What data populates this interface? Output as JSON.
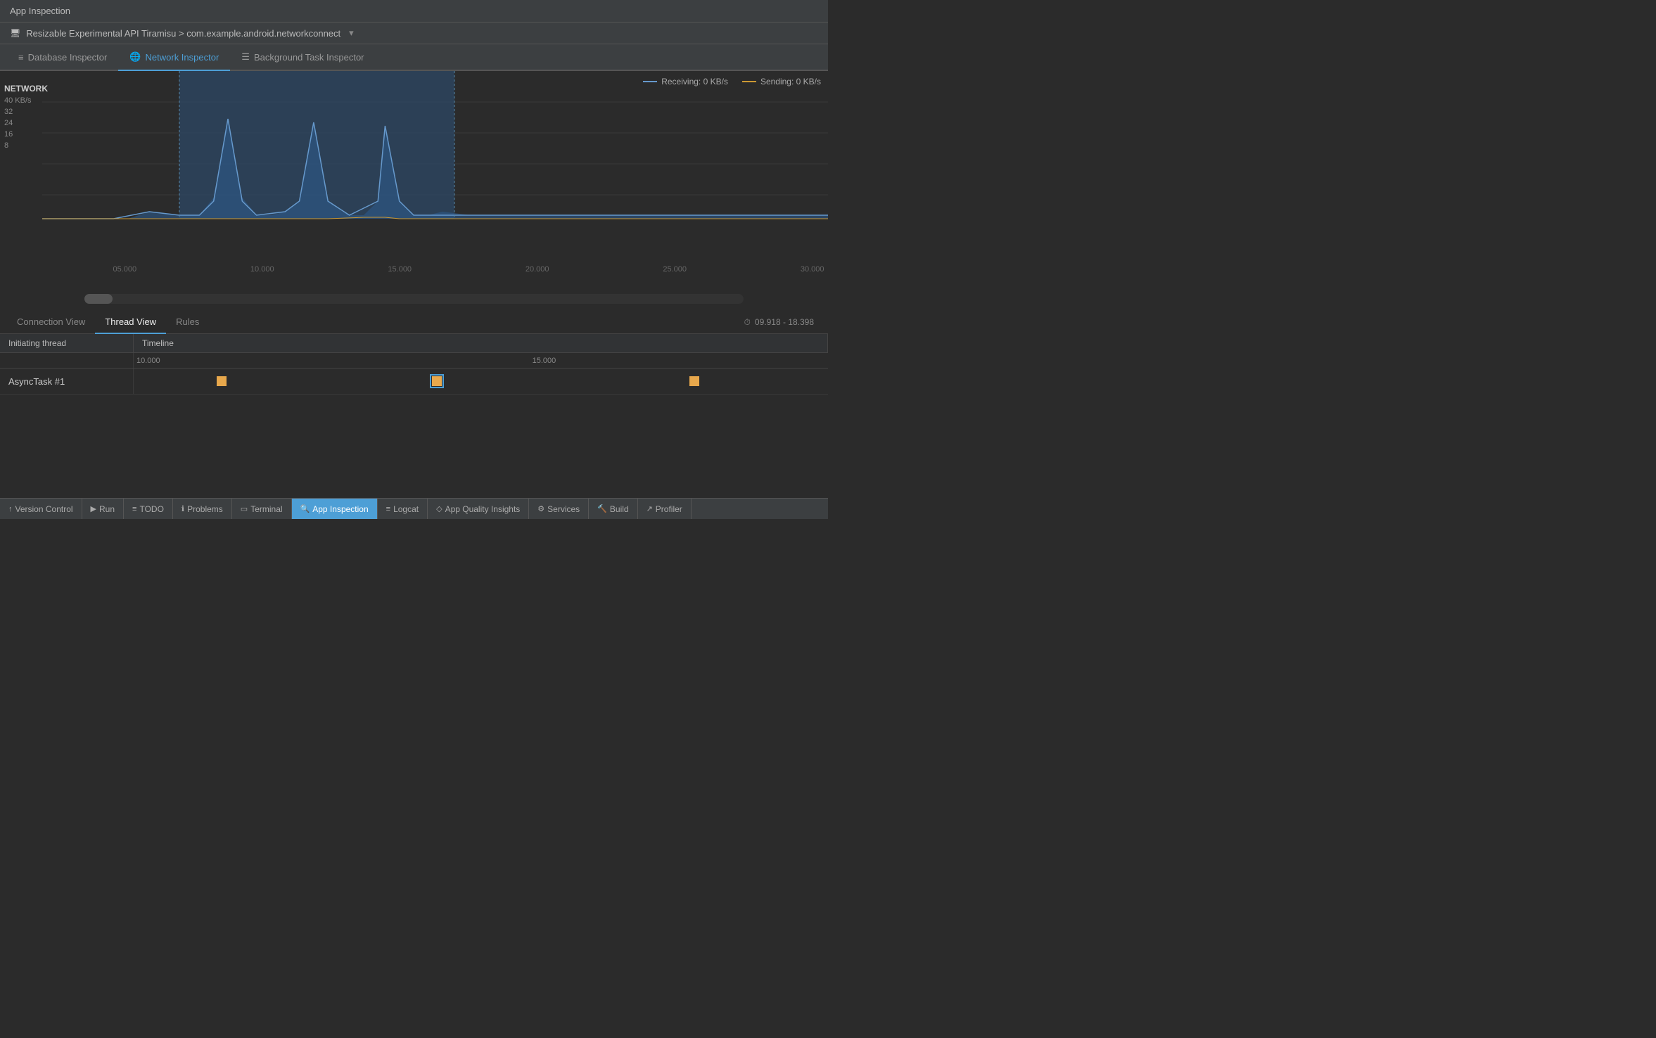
{
  "titleBar": {
    "label": "App Inspection"
  },
  "deviceBar": {
    "deviceName": "Resizable Experimental API Tiramisu > com.example.android.networkconnect",
    "deviceIcon": "🖥"
  },
  "tabs": [
    {
      "id": "database",
      "label": "Database Inspector",
      "icon": "≡",
      "active": false
    },
    {
      "id": "network",
      "label": "Network Inspector",
      "icon": "🌐",
      "active": true
    },
    {
      "id": "background",
      "label": "Background Task Inspector",
      "icon": "☰",
      "active": false
    }
  ],
  "chart": {
    "title": "NETWORK",
    "yLabels": [
      "40 KB/s",
      "32",
      "24",
      "16",
      "8"
    ],
    "timeLabels": [
      "05.000",
      "10.000",
      "15.000",
      "20.000",
      "25.000",
      "30.000"
    ],
    "legend": {
      "receiving": {
        "label": "Receiving: 0 KB/s",
        "color": "#6699cc"
      },
      "sending": {
        "label": "Sending: 0 KB/s",
        "color": "#cc9933"
      }
    },
    "selectionRange": {
      "start": "10.000",
      "end": "17.500"
    }
  },
  "subTabs": [
    {
      "id": "connection",
      "label": "Connection View",
      "active": false
    },
    {
      "id": "thread",
      "label": "Thread View",
      "active": true
    },
    {
      "id": "rules",
      "label": "Rules",
      "active": false
    }
  ],
  "timeRange": {
    "icon": "⏱",
    "value": "09.918 - 18.398"
  },
  "threadTable": {
    "headers": [
      "Initiating thread",
      "Timeline"
    ],
    "rulerLabels": [
      {
        "label": "10.000",
        "pct": 0
      },
      {
        "label": "15.000",
        "pct": 57
      }
    ],
    "rows": [
      {
        "name": "AsyncTask #1",
        "markers": [
          {
            "pct": 12,
            "selected": false
          },
          {
            "pct": 43,
            "selected": true
          },
          {
            "pct": 80,
            "selected": false
          }
        ]
      }
    ]
  },
  "statusBar": {
    "items": [
      {
        "id": "version-control",
        "icon": "↑",
        "label": "Version Control"
      },
      {
        "id": "run",
        "icon": "▶",
        "label": "Run"
      },
      {
        "id": "todo",
        "icon": "≡",
        "label": "TODO"
      },
      {
        "id": "problems",
        "icon": "ℹ",
        "label": "Problems"
      },
      {
        "id": "terminal",
        "icon": "▭",
        "label": "Terminal"
      },
      {
        "id": "app-inspection",
        "icon": "🔍",
        "label": "App Inspection",
        "active": true
      },
      {
        "id": "logcat",
        "icon": "≡",
        "label": "Logcat"
      },
      {
        "id": "app-quality",
        "icon": "◇",
        "label": "App Quality Insights"
      },
      {
        "id": "services",
        "icon": "⚙",
        "label": "Services"
      },
      {
        "id": "build",
        "icon": "🔨",
        "label": "Build"
      },
      {
        "id": "profiler",
        "icon": "↗",
        "label": "Profiler"
      }
    ]
  }
}
